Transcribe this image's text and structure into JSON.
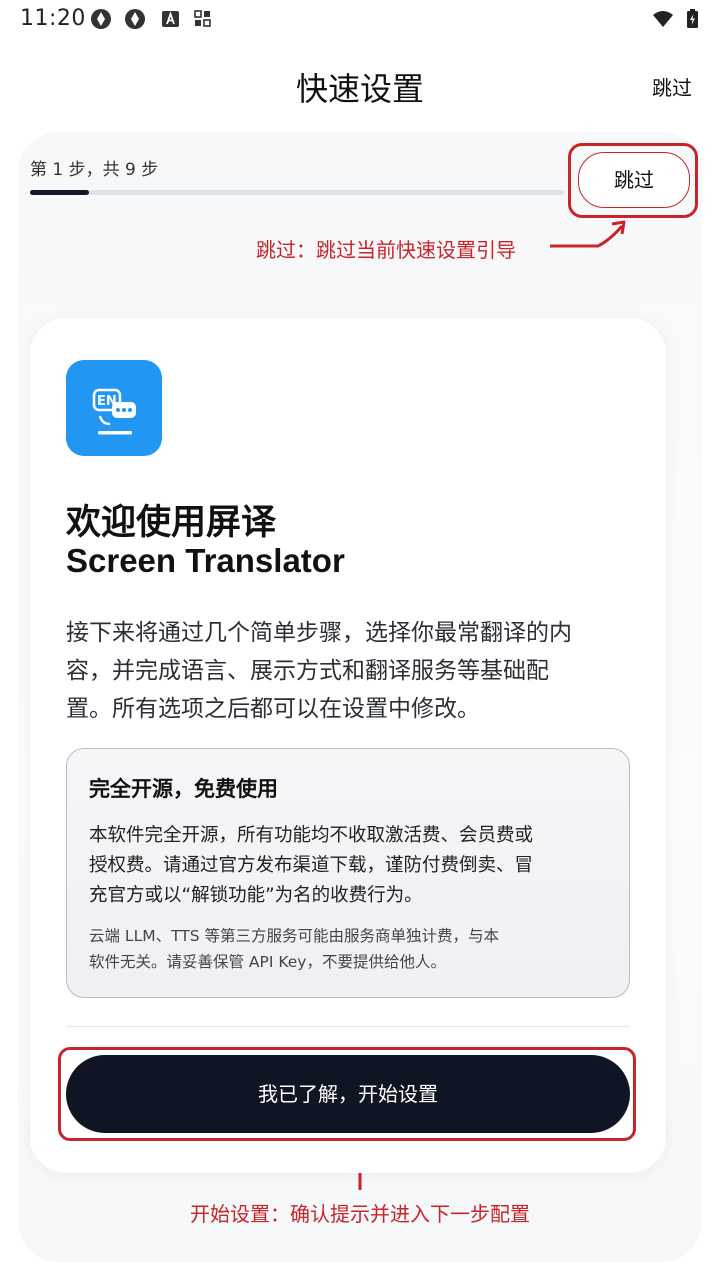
{
  "status_bar": {
    "time": "11:20",
    "icons": [
      "app-notification-icon",
      "app-notification-icon",
      "font-app-icon",
      "qr-app-icon",
      "wifi-icon",
      "battery-charging-icon"
    ]
  },
  "header": {
    "title": "快速设置",
    "skip_label": "跳过"
  },
  "progress": {
    "step_text": "第 1 步，共 9 步",
    "current": 1,
    "total": 9,
    "skip_button_label": "跳过"
  },
  "annotations": {
    "skip": "跳过：跳过当前快速设置引导",
    "start": "开始设置：确认提示并进入下一步配置",
    "color": "#c8252a"
  },
  "card": {
    "icon": "translate-chat-icon",
    "title": "欢迎使用屏译",
    "subtitle": "Screen Translator",
    "desc_lines": [
      "接下来将通过几个简单步骤，选择你最常翻译的内",
      "容，并完成语言、展示方式和翻译服务等基础配",
      "置。所有选项之后都可以在设置中修改。"
    ],
    "notice": {
      "title": "完全开源，免费使用",
      "body_lines": [
        "本软件完全开源，所有功能均不收取激活费、会员费或",
        "授权费。请通过官方发布渠道下载，谨防付费倒卖、冒",
        "充官方或以“解锁功能”为名的收费行为。"
      ],
      "small_lines": [
        "云端 LLM、TTS 等第三方服务可能由服务商单独计费，与本",
        "软件无关。请妥善保管 API Key，不要提供给他人。"
      ]
    },
    "start_button_label": "我已了解，开始设置"
  },
  "colors": {
    "accent_dark": "#0f1522",
    "app_icon_blue": "#2196f3",
    "annotation_red": "#c8252a"
  }
}
